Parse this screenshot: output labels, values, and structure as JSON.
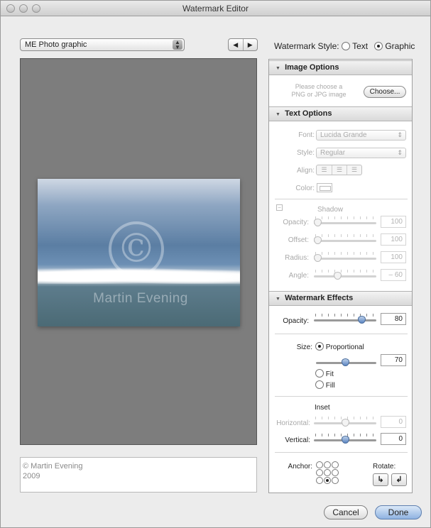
{
  "window": {
    "title": "Watermark Editor"
  },
  "preset": {
    "value": "ME Photo graphic"
  },
  "watermark_style": {
    "label": "Watermark Style:",
    "options": [
      {
        "label": "Text",
        "selected": false
      },
      {
        "label": "Graphic",
        "selected": true
      }
    ]
  },
  "preview": {
    "watermark_text": "Martin Evening",
    "watermark_symbol": "©"
  },
  "caption": {
    "text": "© Martin Evening\n2009"
  },
  "image_options": {
    "header": "Image Options",
    "hint": "Please choose a\nPNG or JPG image",
    "choose_label": "Choose..."
  },
  "text_options": {
    "header": "Text Options",
    "font_label": "Font:",
    "font_value": "Lucida Grande",
    "style_label": "Style:",
    "style_value": "Regular",
    "align_label": "Align:",
    "color_label": "Color:",
    "shadow": {
      "label": "Shadow",
      "opacity_label": "Opacity:",
      "opacity_value": "100",
      "offset_label": "Offset:",
      "offset_value": "100",
      "radius_label": "Radius:",
      "radius_value": "100",
      "angle_label": "Angle:",
      "angle_value": "– 60"
    }
  },
  "watermark_effects": {
    "header": "Watermark Effects",
    "opacity_label": "Opacity:",
    "opacity_value": "80",
    "size_label": "Size:",
    "size_options": [
      {
        "label": "Proportional",
        "selected": true
      },
      {
        "label": "Fit",
        "selected": false
      },
      {
        "label": "Fill",
        "selected": false
      }
    ],
    "size_value": "70",
    "inset_label": "Inset",
    "horizontal_label": "Horizontal:",
    "horizontal_value": "0",
    "vertical_label": "Vertical:",
    "vertical_value": "0",
    "anchor_label": "Anchor:",
    "rotate_label": "Rotate:"
  },
  "buttons": {
    "cancel": "Cancel",
    "done": "Done"
  },
  "icons": {
    "prev": "◀",
    "next": "▶",
    "rotate_cw": "↳",
    "rotate_ccw": "↲",
    "disclosure": "▼"
  }
}
